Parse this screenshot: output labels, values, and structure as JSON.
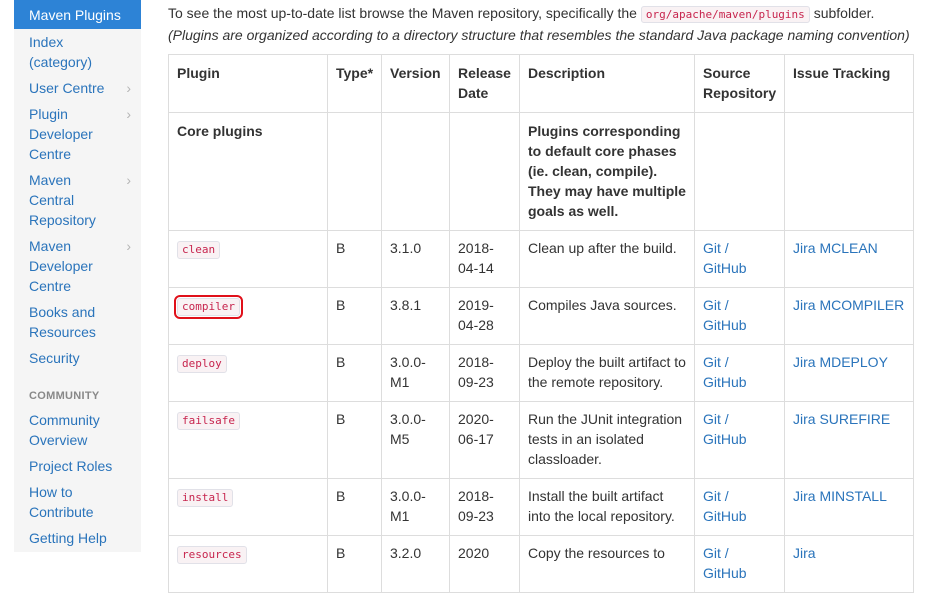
{
  "sidebar": {
    "active_item": "Maven Plugins",
    "items": [
      {
        "label": "Index (category)",
        "chevron": false
      },
      {
        "label": "User Centre",
        "chevron": true
      },
      {
        "label": "Plugin Developer Centre",
        "chevron": true
      },
      {
        "label": "Maven Central Repository",
        "chevron": true
      },
      {
        "label": "Maven Developer Centre",
        "chevron": true
      },
      {
        "label": "Books and Resources",
        "chevron": false
      },
      {
        "label": "Security",
        "chevron": false
      }
    ],
    "community_header": "COMMUNITY",
    "community_items": [
      {
        "label": "Community Overview"
      },
      {
        "label": "Project Roles"
      },
      {
        "label": "How to Contribute"
      },
      {
        "label": "Getting Help"
      }
    ],
    "chevron_glyph": "›"
  },
  "intro": {
    "before": "To see the most up-to-date list browse the Maven repository, specifically the",
    "code": "org/apache/maven/plugins",
    "after": "subfolder.",
    "note": "(Plugins are organized according to a directory structure that resembles the standard Java package naming convention)"
  },
  "table": {
    "headers": {
      "plugin": "Plugin",
      "type": "Type*",
      "version": "Version",
      "release_date": "Release Date",
      "description": "Description",
      "source_repository": "Source Repository",
      "issue_tracking": "Issue Tracking"
    },
    "core_row": {
      "label": "Core plugins",
      "description": "Plugins corresponding to default core phases (ie. clean, compile). They may have multiple goals as well."
    },
    "rows": [
      {
        "plugin": "clean",
        "type": "B",
        "version": "3.1.0",
        "date": "2018-04-14",
        "description": "Clean up after the build.",
        "source": "Git / GitHub",
        "issue": "Jira MCLEAN",
        "highlighted": false
      },
      {
        "plugin": "compiler",
        "type": "B",
        "version": "3.8.1",
        "date": "2019-04-28",
        "description": "Compiles Java sources.",
        "source": "Git / GitHub",
        "issue": "Jira MCOMPILER",
        "highlighted": true
      },
      {
        "plugin": "deploy",
        "type": "B",
        "version": "3.0.0-M1",
        "date": "2018-09-23",
        "description": "Deploy the built artifact to the remote repository.",
        "source": "Git / GitHub",
        "issue": "Jira MDEPLOY",
        "highlighted": false
      },
      {
        "plugin": "failsafe",
        "type": "B",
        "version": "3.0.0-M5",
        "date": "2020-06-17",
        "description": "Run the JUnit integration tests in an isolated classloader.",
        "source": "Git / GitHub",
        "issue": "Jira SUREFIRE",
        "highlighted": false
      },
      {
        "plugin": "install",
        "type": "B",
        "version": "3.0.0-M1",
        "date": "2018-09-23",
        "description": "Install the built artifact into the local repository.",
        "source": "Git / GitHub",
        "issue": "Jira MINSTALL",
        "highlighted": false
      },
      {
        "plugin": "resources",
        "type": "B",
        "version": "3.2.0",
        "date": "2020",
        "description": "Copy the resources to",
        "source": "Git / GitHub",
        "issue": "Jira",
        "highlighted": false
      }
    ]
  },
  "colors": {
    "sidebar_active_bg": "#2d83d6",
    "link": "#2a74bb",
    "code_text": "#c7254e",
    "highlight_box": "#e0101a"
  }
}
